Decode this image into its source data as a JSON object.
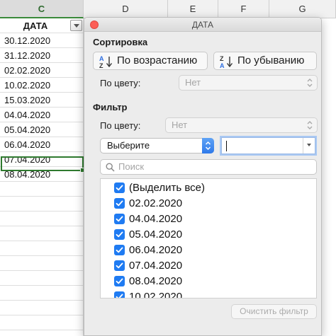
{
  "sheet": {
    "columns": [
      "C",
      "D",
      "E",
      "F",
      "G"
    ],
    "header": "ДАТА",
    "rows": [
      "30.12.2020",
      "31.12.2020",
      "02.02.2020",
      "10.02.2020",
      "15.03.2020",
      "04.04.2020",
      "05.04.2020",
      "06.04.2020",
      "07.04.2020",
      "08.04.2020"
    ]
  },
  "panel": {
    "title": "ДАТА",
    "sort": {
      "heading": "Сортировка",
      "ascending_label": "По возрастанию",
      "descending_label": "По убыванию",
      "by_color_label": "По цвету:",
      "by_color_value": "Нет"
    },
    "filter": {
      "heading": "Фильтр",
      "by_color_label": "По цвету:",
      "by_color_value": "Нет",
      "condition_value": "Выберите",
      "value_text": "",
      "search_placeholder": "Поиск",
      "items": [
        {
          "label": "(Выделить все)",
          "checked": true
        },
        {
          "label": "02.02.2020",
          "checked": true
        },
        {
          "label": "04.04.2020",
          "checked": true
        },
        {
          "label": "05.04.2020",
          "checked": true
        },
        {
          "label": "06.04.2020",
          "checked": true
        },
        {
          "label": "07.04.2020",
          "checked": true
        },
        {
          "label": "08.04.2020",
          "checked": true
        },
        {
          "label": "10.02.2020",
          "checked": true
        }
      ],
      "clear_label": "Очистить фильтр"
    }
  },
  "colors": {
    "accent": "#1f7bf2",
    "close": "#fc5f57",
    "active_cell": "#2f7a2f"
  }
}
